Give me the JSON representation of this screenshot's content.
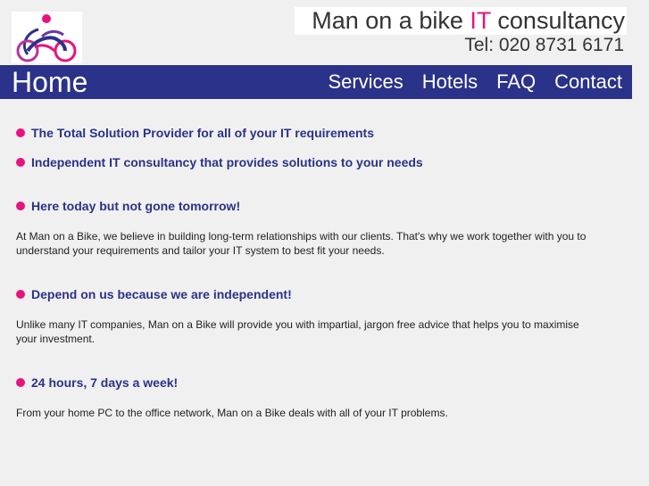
{
  "brand": {
    "name": "Man on a bike",
    "name_highlight": "IT",
    "name_suffix": "consultancy",
    "phone": "Tel: 020 8731 6171"
  },
  "nav": {
    "current": "Home",
    "links": [
      {
        "label": "Services"
      },
      {
        "label": "Hotels"
      },
      {
        "label": "FAQ"
      },
      {
        "label": "Contact"
      }
    ]
  },
  "content": {
    "tagline1": "The Total Solution Provider for all of your IT requirements",
    "tagline2": "Independent IT consultancy that provides solutions to your needs",
    "sections": [
      {
        "heading": "Here today but not gone tomorrow!",
        "text": "At Man on a Bike, we believe in building long-term relationships with our clients. That's why we work together with you to understand your requirements and tailor your IT system to best fit your needs."
      },
      {
        "heading": "Depend on us because we are independent!",
        "text": "Unlike many IT companies, Man on a Bike will provide you with impartial, jargon free advice that helps you to maximise your investment."
      },
      {
        "heading": "24 hours, 7 days a week!",
        "text": "From your home PC to the office network, Man on a Bike deals with all of your IT problems."
      }
    ]
  },
  "colors": {
    "accent": "#e8127f",
    "navy": "#2b3289",
    "background": "#f0f0f0"
  }
}
